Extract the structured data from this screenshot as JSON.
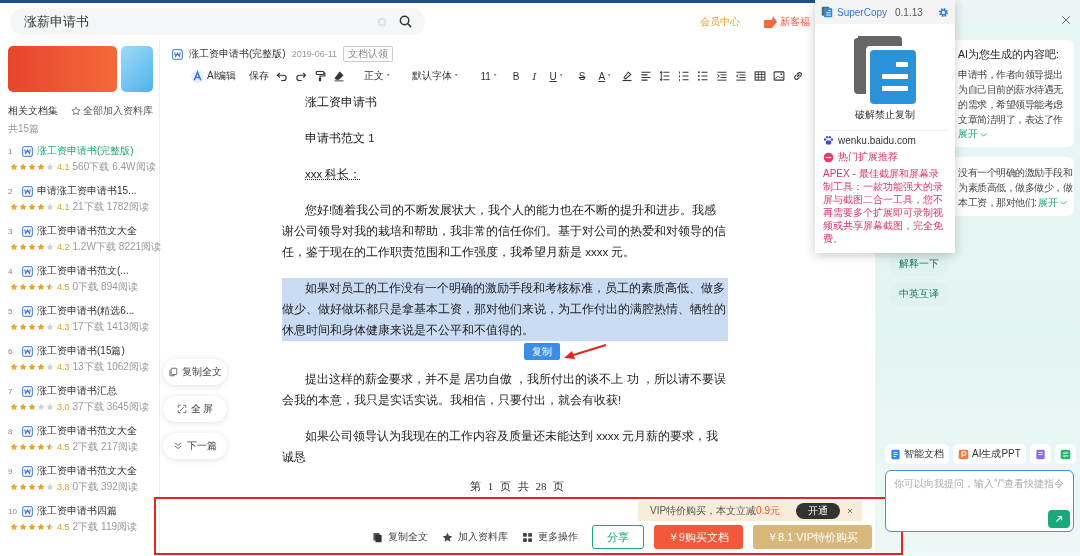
{
  "search": {
    "value": "涨薪申请书"
  },
  "header_links": [
    {
      "kind": "member",
      "label": "会员中心"
    },
    {
      "kind": "promo",
      "label": "新客福"
    }
  ],
  "sidebar": {
    "title": "相关文档集",
    "add_all": "全部加入资料库",
    "count": "共15篇",
    "items": [
      {
        "number": "1",
        "title": "涨工资申请书(完整版)",
        "stars": 4,
        "rating": "4.1",
        "downloads": "560下载",
        "reads": "6.4W阅读",
        "selected": true
      },
      {
        "number": "2",
        "title": "申请涨工资申请书15...",
        "stars": 4,
        "rating": "4.1",
        "downloads": "21下载",
        "reads": "1782阅读",
        "selected": false
      },
      {
        "number": "3",
        "title": "涨工资申请书范文大全",
        "stars": 4,
        "rating": "4.2",
        "downloads": "1.2W下载",
        "reads": "8221阅读",
        "selected": false
      },
      {
        "number": "4",
        "title": "涨工资申请书范文(...",
        "stars": 4.5,
        "rating": "4.5",
        "downloads": "0下载",
        "reads": "894阅读",
        "selected": false
      },
      {
        "number": "5",
        "title": "涨工资申请书(精选6...",
        "stars": 4,
        "rating": "4.3",
        "downloads": "17下载",
        "reads": "1413阅读",
        "selected": false
      },
      {
        "number": "6",
        "title": "涨工资申请书(15篇)",
        "stars": 4,
        "rating": "4.3",
        "downloads": "13下载",
        "reads": "1062阅读",
        "selected": false
      },
      {
        "number": "7",
        "title": "涨工资申请书汇总",
        "stars": 3,
        "rating": "3.0",
        "downloads": "37下载",
        "reads": "3645阅读",
        "selected": false
      },
      {
        "number": "8",
        "title": "涨工资申请书范文大全",
        "stars": 4.5,
        "rating": "4.5",
        "downloads": "2下载",
        "reads": "217阅读",
        "selected": false
      },
      {
        "number": "9",
        "title": "涨工资申请书范文大全",
        "stars": 4,
        "rating": "3.8",
        "downloads": "0下载",
        "reads": "392阅读",
        "selected": false
      },
      {
        "number": "10",
        "title": "涨工资申请书四篇",
        "stars": 4.5,
        "rating": "4.5",
        "downloads": "2下载",
        "reads": "119阅读",
        "selected": false
      }
    ]
  },
  "document": {
    "title": "涨工资申请书(完整版)",
    "date": "2019-06-11",
    "tag": "文档认领",
    "toolbar": {
      "ai": "AI编辑",
      "save": "保存",
      "dropdowns": [
        "正文",
        "默认字体",
        "11"
      ],
      "format": [
        {
          "kind": "bold",
          "glyph": "B"
        },
        {
          "kind": "italic",
          "glyph": "I"
        },
        {
          "kind": "underline",
          "glyph": "U"
        },
        {
          "kind": "strike",
          "glyph": "S"
        },
        {
          "kind": "color",
          "glyph": "A"
        }
      ]
    },
    "paragraphs": [
      {
        "kind": "title",
        "text": "涨工资申请书",
        "highlighted": false
      },
      {
        "kind": "title",
        "text": "申请书范文 1",
        "highlighted": false
      },
      {
        "kind": "salutation",
        "text": "xxx 科长：",
        "highlighted": false
      },
      {
        "kind": "body",
        "text": "您好!随着我公司的不断发展状大，我个人的能力也在不断的提升和进步。我感谢公司领导对我的栽培和帮助，我非常的信任你们。基于对公司的热爱和对领导的信任，鉴于现在的工作职责范围和工作强度，我希望月薪是 xxxx 元。",
        "highlighted": false
      },
      {
        "kind": "body",
        "text": "如果对员工的工作没有一个明确的激励手段和考核标准，员工的素质高低、做多做少、做好做坏都只是拿基本工资，那对他们来说，为工作付出的满腔热情、牺牲的休息时间和身体健康来说是不公平和不值得的。",
        "highlighted": true,
        "copy_tip": "复制"
      },
      {
        "kind": "body",
        "text": "提出这样的薪金要求，并不是 居功自傲 ，我所付出的谈不上 功 ，所以请不要误会我的本意，我只是实话实说。我相信，只要付出，就会有收获!",
        "highlighted": false
      },
      {
        "kind": "body",
        "text": "如果公司领导认为我现在的工作内容及质量还未能达到  xxxx  元月薪的要求，我诚恳",
        "highlighted": false
      }
    ],
    "page": "第 1 页 共 28 页"
  },
  "float_actions": [
    {
      "kind": "copy",
      "label": "复制全文"
    },
    {
      "kind": "fullscreen",
      "label": "全 屏"
    },
    {
      "kind": "next",
      "label": "下一篇"
    }
  ],
  "promo": {
    "text": "VIP特价购买，本文立减",
    "discount": "0.9元",
    "button": "开通"
  },
  "bottom_actions": [
    {
      "kind": "copy",
      "label": "复制全文"
    },
    {
      "kind": "favorite",
      "label": "加入资料库"
    },
    {
      "kind": "more",
      "label": "更多操作"
    }
  ],
  "buy_buttons": [
    {
      "kind": "outline",
      "label": "分享"
    },
    {
      "kind": "primary",
      "label": "￥9购买文档"
    },
    {
      "kind": "vip",
      "label": "￥8.1 VIP特价购买"
    }
  ],
  "ai_panel": {
    "cards": [
      {
        "title": "AI为您生成的内容吧:",
        "lines": [
          "申请书，作者向领导提出",
          "为自己目前的薪水待遇无",
          "的需求，希望领导能考虑",
          "文章简洁明了，表达了作"
        ],
        "expand": "展开"
      },
      {
        "lines": [
          "没有一个明确的激励手段和",
          "为素质高低，做多做少，做",
          "本工资，那对他们:"
        ],
        "expand": "展开"
      }
    ],
    "chips": [
      "解释一下",
      "中英互译"
    ],
    "tools": [
      {
        "kind": "doc",
        "label": "智能文档"
      },
      {
        "kind": "ppt",
        "label": "AI生成PPT"
      },
      {
        "kind": "note"
      },
      {
        "kind": "convert"
      }
    ],
    "input_placeholder": "你可以向我提问，输入\"/\"查看快捷指令"
  },
  "extension_popup": {
    "name": "SuperCopy",
    "version": "0.1.13",
    "action": "破解禁止复制",
    "site": "wenku.baidu.com",
    "recommend_title": "热门扩展推荐",
    "recommend_text": "APEX - 最佳截屏和屏幕录制工具：一款功能强大的录屏与截图二合一工具，您不再需要多个扩展即可录制视频或共享屏幕截图，完全免费。"
  }
}
